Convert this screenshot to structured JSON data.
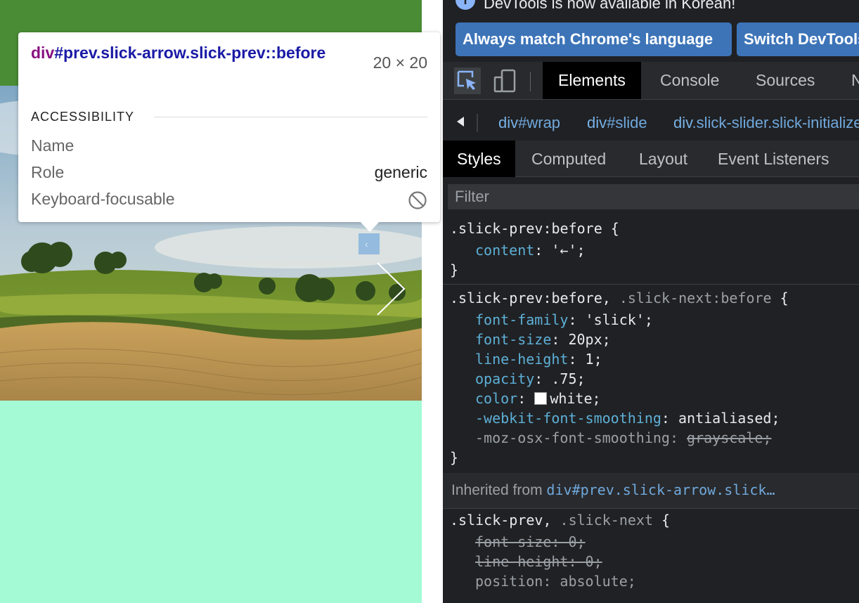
{
  "tooltip": {
    "title_tag": "div",
    "title_rest": "#prev.slick-arrow.slick-prev::before",
    "size": "20 × 20",
    "section": "ACCESSIBILITY",
    "rows": [
      {
        "label": "Name",
        "value": ""
      },
      {
        "label": "Role",
        "value": "generic"
      },
      {
        "label": "Keyboard-focusable",
        "value": "blocked-icon"
      }
    ]
  },
  "devtools": {
    "infobar": {
      "message": "DevTools is now available in Korean!",
      "match_button": "Always match Chrome's language",
      "switch_button": "Switch DevTools to Korean"
    },
    "main_tabs": [
      "Elements",
      "Console",
      "Sources",
      "Network"
    ],
    "active_main_tab": "Elements",
    "breadcrumbs": [
      {
        "tag": "div",
        "rest": "#wrap"
      },
      {
        "tag": "div",
        "rest": "#slide"
      },
      {
        "tag": "div",
        "rest": ".slick-slider.slick-initialized"
      }
    ],
    "sub_tabs": [
      "Styles",
      "Computed",
      "Layout",
      "Event Listeners"
    ],
    "active_sub_tab": "Styles",
    "filter_placeholder": "Filter",
    "rule1": {
      "selector": ".slick-prev:before {",
      "decls": [
        {
          "prop": "content",
          "value": "'←';"
        }
      ],
      "close": "}"
    },
    "rule2": {
      "selector_main": ".slick-prev:before,",
      "selector_dim": ".slick-next:before",
      "brace": "{",
      "decls": [
        {
          "prop": "font-family",
          "value": "'slick';"
        },
        {
          "prop": "font-size",
          "value": "20px;"
        },
        {
          "prop": "line-height",
          "value": "1;"
        },
        {
          "prop": "opacity",
          "value": ".75;"
        },
        {
          "prop": "color",
          "value": "white;"
        },
        {
          "prop": "-webkit-font-smoothing",
          "value": "antialiased;"
        },
        {
          "prop": "-moz-osx-font-smoothing",
          "value": "grayscale;"
        }
      ],
      "close": "}"
    },
    "inherited": {
      "label": "Inherited from",
      "link": "div#prev.slick-arrow.slick…"
    },
    "rule3": {
      "selector_main": ".slick-prev,",
      "selector_dim": ".slick-next",
      "brace": "{",
      "decls": [
        {
          "prop": "font-size",
          "value": "0;"
        },
        {
          "prop": "line-height",
          "value": "0;"
        },
        {
          "prop": "position",
          "value": "absolute;"
        }
      ]
    }
  },
  "colors": {
    "green_bar": "#4a8c36",
    "mint": "#a4fad4",
    "button_blue": "#3d74b8",
    "devtools_bg": "#202124"
  }
}
